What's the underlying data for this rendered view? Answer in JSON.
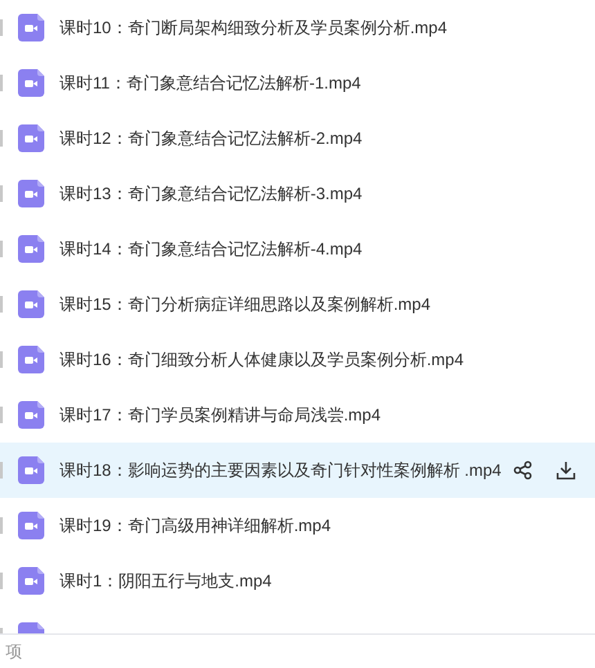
{
  "files": [
    {
      "name": "课时10：奇门断局架构细致分析及学员案例分析.mp4",
      "hovered": false
    },
    {
      "name": "课时11：奇门象意结合记忆法解析-1.mp4",
      "hovered": false
    },
    {
      "name": "课时12：奇门象意结合记忆法解析-2.mp4",
      "hovered": false
    },
    {
      "name": "课时13：奇门象意结合记忆法解析-3.mp4",
      "hovered": false
    },
    {
      "name": "课时14：奇门象意结合记忆法解析-4.mp4",
      "hovered": false
    },
    {
      "name": "课时15：奇门分析病症详细思路以及案例解析.mp4",
      "hovered": false
    },
    {
      "name": "课时16：奇门细致分析人体健康以及学员案例分析.mp4",
      "hovered": false
    },
    {
      "name": "课时17：奇门学员案例精讲与命局浅尝.mp4",
      "hovered": false
    },
    {
      "name": "课时18：影响运势的主要因素以及奇门针对性案例解析 .mp4",
      "hovered": true
    },
    {
      "name": "课时19：奇门高级用神详细解析.mp4",
      "hovered": false
    },
    {
      "name": "课时1：阴阳五行与地支.mp4",
      "hovered": false
    },
    {
      "hovered": false
    }
  ],
  "footer": {
    "count": "项"
  }
}
